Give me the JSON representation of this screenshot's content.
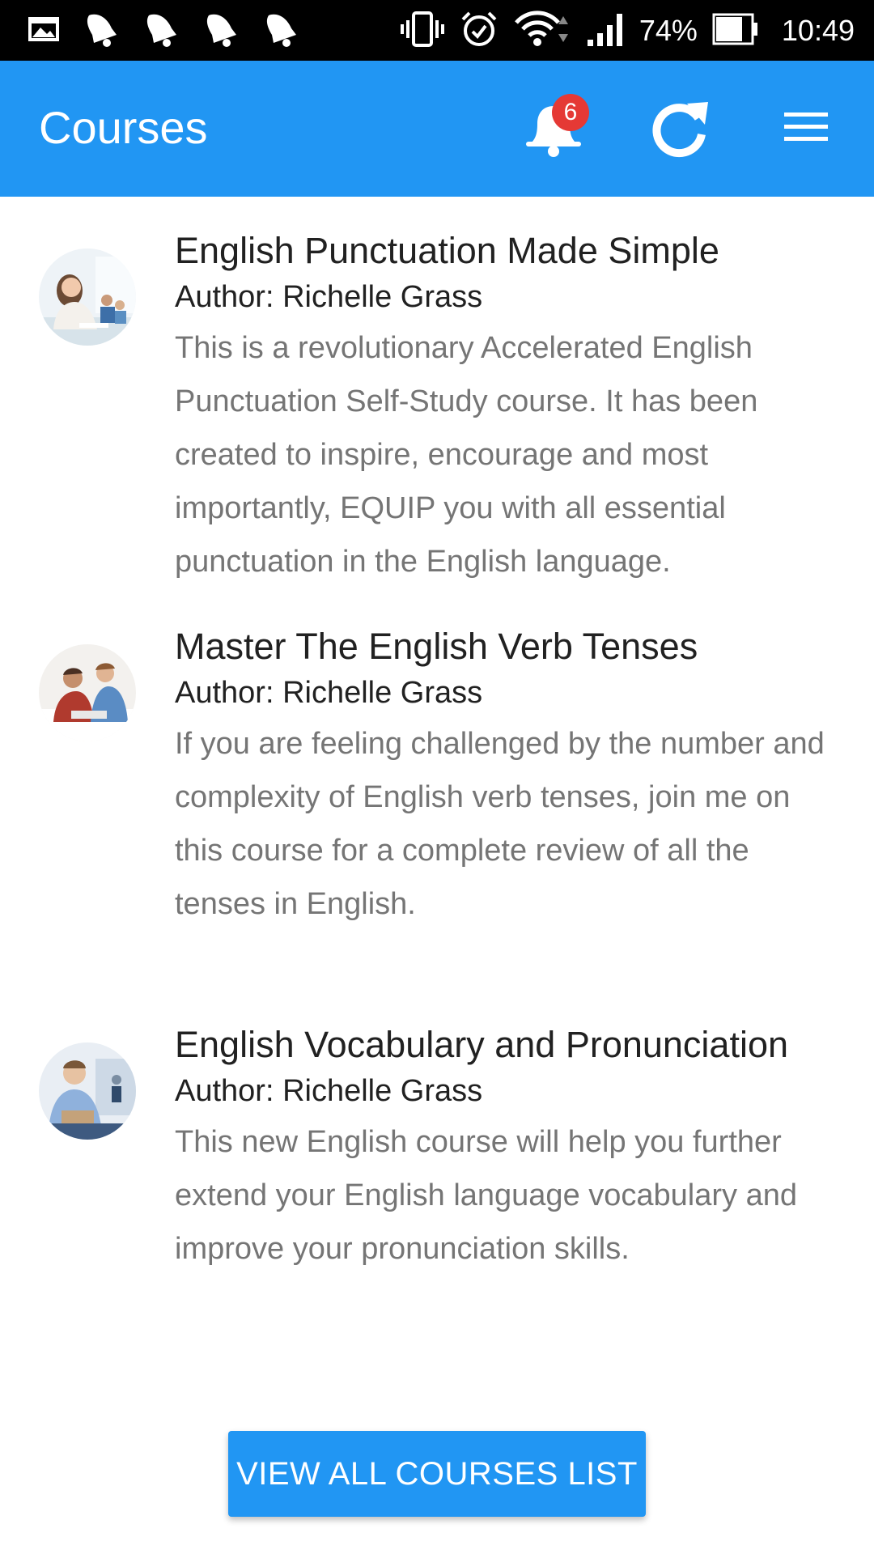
{
  "status_bar": {
    "icons_left": [
      "gallery-icon",
      "notification-bell-icon",
      "notification-bell-icon",
      "notification-bell-icon",
      "notification-bell-icon"
    ],
    "icons_right": [
      "vibrate-icon",
      "alarm-icon",
      "wifi-icon",
      "signal-icon",
      "battery-icon"
    ],
    "battery_percent": "74%",
    "time": "10:49"
  },
  "app_bar": {
    "title": "Courses",
    "notification_count": "6",
    "actions": [
      "bell-icon",
      "refresh-icon",
      "menu-icon"
    ],
    "color": "#2196f3"
  },
  "courses": [
    {
      "title": "English Punctuation Made Simple",
      "author": "Author: Richelle Grass",
      "description": "This is a revolutionary Accelerated English Punctuation Self-Study course. It has been created to inspire, encourage and most importantly, EQUIP you with all essential punctuation in the English language."
    },
    {
      "title": "Master The English Verb Tenses",
      "author": "Author: Richelle Grass",
      "description": "If you are feeling challenged by the number and complexity of English verb tenses, join me on this course for a complete review of all the tenses in English."
    },
    {
      "title": "English Vocabulary and Pronunciation",
      "author": "Author: Richelle Grass",
      "description": "This new English course will help you further extend your English language vocabulary and improve your pronunciation skills."
    }
  ],
  "view_all_button": {
    "label": "VIEW ALL COURSES LIST"
  }
}
